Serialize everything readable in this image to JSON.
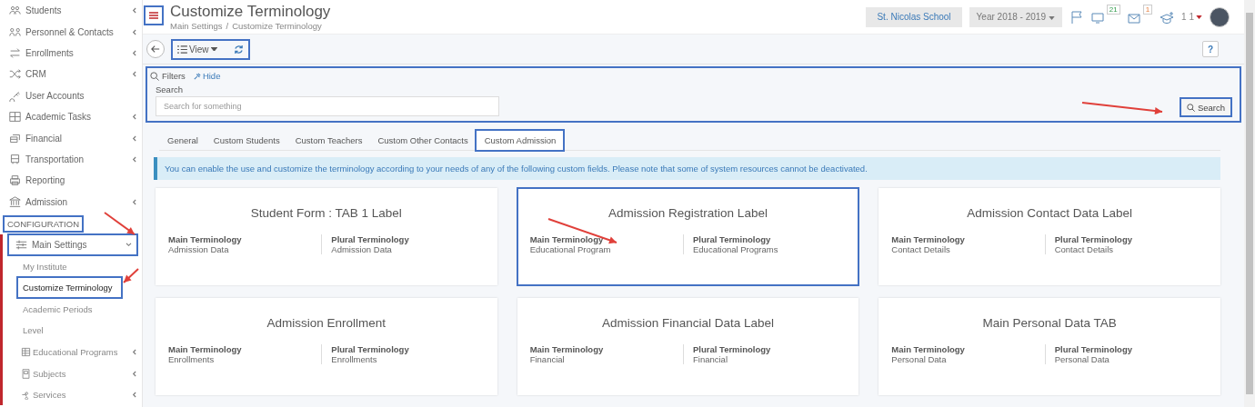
{
  "sidebar": {
    "items": [
      {
        "label": "Students",
        "has_children": true
      },
      {
        "label": "Personnel & Contacts",
        "has_children": true
      },
      {
        "label": "Enrollments",
        "has_children": true
      },
      {
        "label": "CRM",
        "has_children": true
      },
      {
        "label": "User Accounts",
        "has_children": false
      },
      {
        "label": "Academic Tasks",
        "has_children": true
      },
      {
        "label": "Financial",
        "has_children": true
      },
      {
        "label": "Transportation",
        "has_children": true
      },
      {
        "label": "Reporting",
        "has_children": false
      },
      {
        "label": "Admission",
        "has_children": true
      }
    ],
    "section": {
      "label": "CONFIGURATION",
      "highlighted": true
    },
    "group": {
      "label": "Main Settings",
      "expanded": true,
      "highlighted": true,
      "children": [
        {
          "label": "My Institute",
          "selected": false,
          "highlighted": false,
          "has_children": false,
          "has_icon": false
        },
        {
          "label": "Customize Terminology",
          "selected": true,
          "highlighted": true,
          "has_children": false,
          "has_icon": false
        },
        {
          "label": "Academic Periods",
          "selected": false,
          "highlighted": false,
          "has_children": false,
          "has_icon": false
        },
        {
          "label": "Level",
          "selected": false,
          "highlighted": false,
          "has_children": false,
          "has_icon": false
        },
        {
          "label": "Educational Programs",
          "selected": false,
          "highlighted": false,
          "has_children": true,
          "has_icon": true
        },
        {
          "label": "Subjects",
          "selected": false,
          "highlighted": false,
          "has_children": true,
          "has_icon": true
        },
        {
          "label": "Services",
          "selected": false,
          "highlighted": false,
          "has_children": true,
          "has_icon": true
        }
      ]
    }
  },
  "header": {
    "menu_highlighted": true,
    "title": "Customize Terminology",
    "breadcrumb": [
      "Main Settings",
      "Customize Terminology"
    ],
    "breadcrumb_separator": "/",
    "school": "St. Nicolas School",
    "year": "Year 2018 - 2019",
    "tasks_badge": "21",
    "mail_badge": "1",
    "user": "1 1"
  },
  "toolbar": {
    "highlighted": true,
    "view": "View",
    "help": "?"
  },
  "filters": {
    "highlighted": true,
    "title": "Filters",
    "hide": "Hide",
    "search_label": "Search",
    "placeholder": "Search for something",
    "button": "Search",
    "button_highlighted": true
  },
  "tabs": [
    {
      "label": "General",
      "selected": false,
      "highlighted": false
    },
    {
      "label": "Custom Students",
      "selected": false,
      "highlighted": false
    },
    {
      "label": "Custom Teachers",
      "selected": false,
      "highlighted": false
    },
    {
      "label": "Custom Other Contacts",
      "selected": false,
      "highlighted": false
    },
    {
      "label": "Custom Admission",
      "selected": true,
      "highlighted": true
    }
  ],
  "info": "You can enable the use and customize the terminology according to your needs of any of the following custom fields. Please note that some of system resources cannot be deactivated.",
  "cards": [
    {
      "title": "Student Form : TAB 1 Label",
      "main_label": "Main Terminology",
      "main": "Admission Data",
      "plural_label": "Plural Terminology",
      "plural": "Admission Data",
      "highlighted": false
    },
    {
      "title": "Admission Registration Label",
      "main_label": "Main Terminology",
      "main": "Educational Program",
      "plural_label": "Plural Terminology",
      "plural": "Educational Programs",
      "highlighted": true
    },
    {
      "title": "Admission Contact Data Label",
      "main_label": "Main Terminology",
      "main": "Contact Details",
      "plural_label": "Plural Terminology",
      "plural": "Contact Details",
      "highlighted": false
    },
    {
      "title": "Admission Enrollment",
      "main_label": "Main Terminology",
      "main": "Enrollments",
      "plural_label": "Plural Terminology",
      "plural": "Enrollments",
      "highlighted": false
    },
    {
      "title": "Admission Financial Data Label",
      "main_label": "Main Terminology",
      "main": "Financial",
      "plural_label": "Plural Terminology",
      "plural": "Financial",
      "highlighted": false
    },
    {
      "title": "Main Personal Data TAB",
      "main_label": "Main Terminology",
      "main": "Personal Data",
      "plural_label": "Plural Terminology",
      "plural": "Personal Data",
      "highlighted": false
    }
  ]
}
